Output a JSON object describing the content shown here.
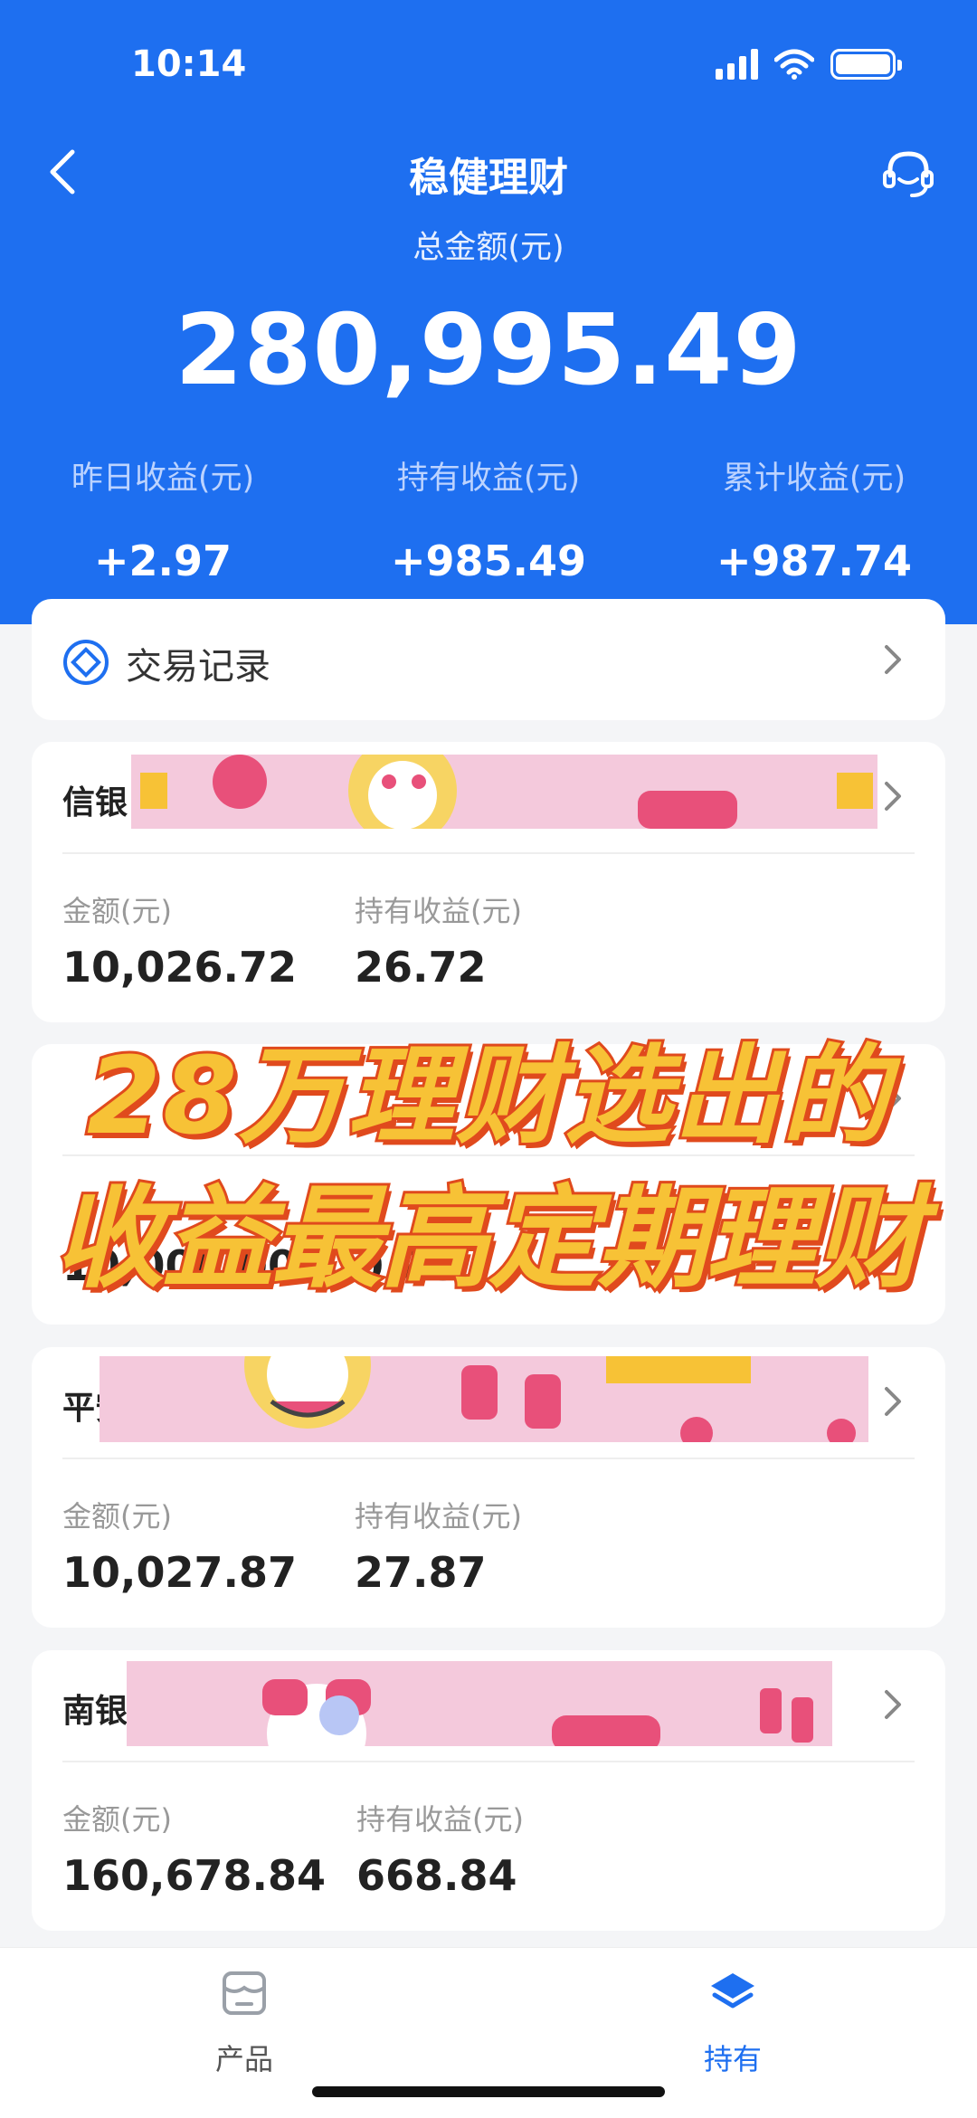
{
  "status_bar": {
    "time": "10:14"
  },
  "header": {
    "title": "稳健理财",
    "total_label": "总金额(元)",
    "total_amount": "280,995.49",
    "stats": [
      {
        "label": "昨日收益(元)",
        "value": "+2.97"
      },
      {
        "label": "持有收益(元)",
        "value": "+985.49"
      },
      {
        "label": "累计收益(元)",
        "value": "+987.74"
      }
    ]
  },
  "trade_record": {
    "label": "交易记录"
  },
  "products": [
    {
      "name": "信银",
      "amount_label": "金额(元)",
      "amount": "10,026.72",
      "profit_label": "持有收益(元)",
      "profit": "26.72"
    },
    {
      "name": "",
      "amount_label": "",
      "amount": "10,000.00",
      "profit_label": "",
      "profit": "0.00"
    },
    {
      "name": "平安",
      "amount_label": "金额(元)",
      "amount": "10,027.87",
      "profit_label": "持有收益(元)",
      "profit": "27.87"
    },
    {
      "name": "南银",
      "amount_label": "金额(元)",
      "amount": "160,678.84",
      "profit_label": "持有收益(元)",
      "profit": "668.84"
    }
  ],
  "overlay": {
    "line1": "28万理财选出的",
    "line2": "收益最高定期理财"
  },
  "bottom_nav": {
    "items": [
      {
        "label": "产品",
        "icon": "shop-icon",
        "active": false
      },
      {
        "label": "持有",
        "icon": "layers-icon",
        "active": true
      }
    ]
  },
  "colors": {
    "primary": "#1e6ff0",
    "overlay_fill": "#f7c236",
    "overlay_stroke": "#e04a1d",
    "banner_pink": "#f4c9dc"
  }
}
